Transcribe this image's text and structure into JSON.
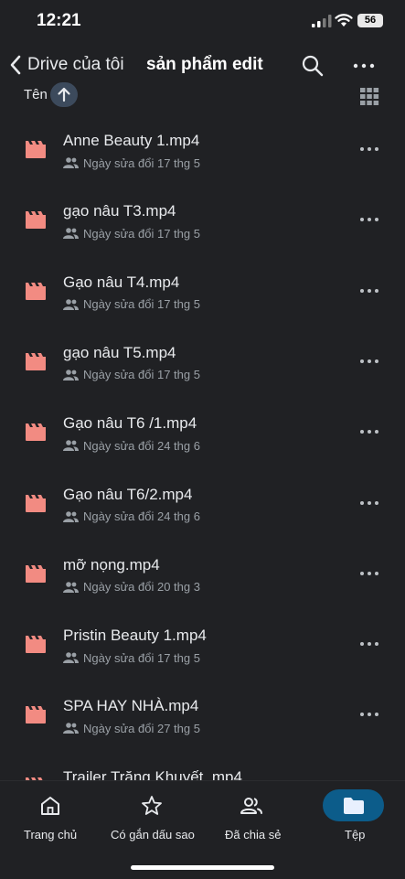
{
  "status_bar": {
    "time": "12:21",
    "battery": "56"
  },
  "header": {
    "back_label": "Drive của tôi",
    "title": "sản phẩm edit"
  },
  "sort": {
    "label": "Tên",
    "direction": "ascending"
  },
  "files": [
    {
      "name": "Anne Beauty 1.mp4",
      "modified": "Ngày sửa đổi 17 thg 5"
    },
    {
      "name": "gạo nâu T3.mp4",
      "modified": "Ngày sửa đổi 17 thg 5"
    },
    {
      "name": "Gạo nâu T4.mp4",
      "modified": "Ngày sửa đổi 17 thg 5"
    },
    {
      "name": "gạo nâu T5.mp4",
      "modified": "Ngày sửa đổi 17 thg 5"
    },
    {
      "name": "Gạo nâu T6 /1.mp4",
      "modified": "Ngày sửa đổi 24 thg 6"
    },
    {
      "name": "Gạo nâu T6/2.mp4",
      "modified": "Ngày sửa đổi 24 thg 6"
    },
    {
      "name": "mỡ nọng.mp4",
      "modified": "Ngày sửa đổi 20 thg 3"
    },
    {
      "name": "Pristin Beauty 1.mp4",
      "modified": "Ngày sửa đổi 17 thg 5"
    },
    {
      "name": "SPA HAY NHÀ.mp4",
      "modified": "Ngày sửa đổi 27 thg 5"
    },
    {
      "name": "Trailer    Trăng Khuyết    .mp4",
      "modified": ""
    }
  ],
  "bottom_nav": [
    {
      "label": "Trang chủ",
      "icon": "home-icon"
    },
    {
      "label": "Có gắn dấu sao",
      "icon": "star-icon"
    },
    {
      "label": "Đã chia sẻ",
      "icon": "shared-people-icon"
    },
    {
      "label": "Tệp",
      "icon": "folder-icon",
      "active": true
    }
  ],
  "colors": {
    "background": "#202124",
    "file_icon": "#f28b82",
    "active_nav": "#0c5c8a"
  }
}
